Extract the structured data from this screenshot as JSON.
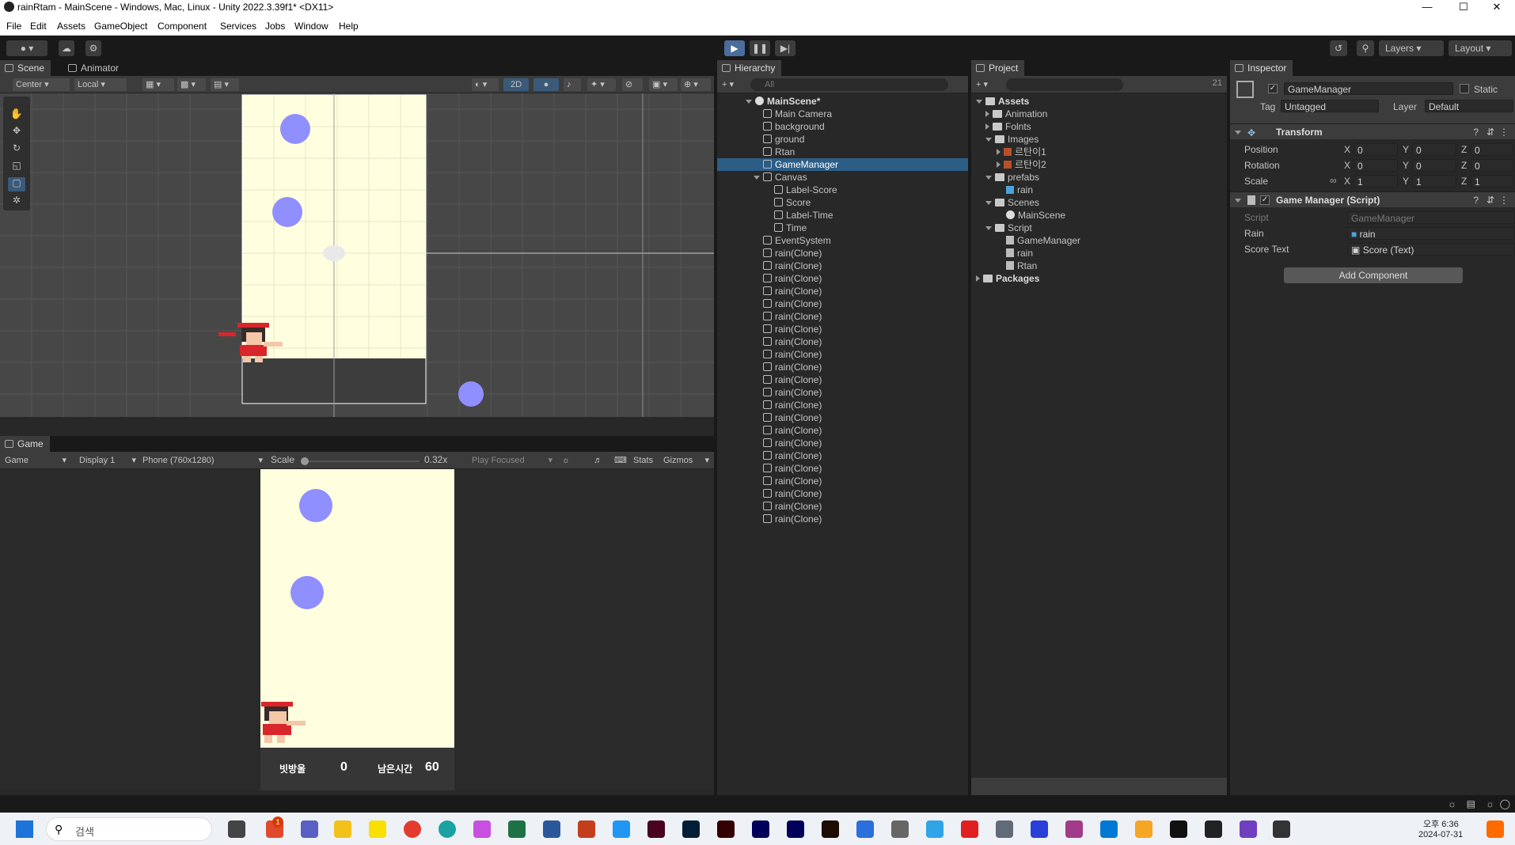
{
  "window": {
    "title": "rainRtam - MainScene - Windows, Mac, Linux - Unity 2022.3.39f1* <DX11>"
  },
  "menu": [
    "File",
    "Edit",
    "Assets",
    "GameObject",
    "Component",
    "Services",
    "Jobs",
    "Window",
    "Help"
  ],
  "toolbar": {
    "layers_label": "Layers",
    "layout_label": "Layout"
  },
  "scene_panel": {
    "tabs": [
      "Scene",
      "Animator"
    ],
    "pivot_label": "Center",
    "space_label": "Local",
    "mode_2d": "2D"
  },
  "game_panel": {
    "tab": "Game",
    "view_select": "Game",
    "display_select": "Display 1",
    "resolution_select": "Phone (760x1280)",
    "scale_label": "Scale",
    "scale_value": 0.32,
    "scale_text": "0.32x",
    "play_mode": "Play Focused",
    "stats_label": "Stats",
    "gizmos_label": "Gizmos",
    "hud": {
      "score_label": "빗방울",
      "score_value": "0",
      "time_label": "남은시간",
      "time_value": "60"
    }
  },
  "hierarchy": {
    "tab": "Hierarchy",
    "search_placeholder": "All",
    "scene": "MainScene*",
    "items": [
      "Main Camera",
      "background",
      "ground",
      "Rtan",
      "GameManager"
    ],
    "canvas": "Canvas",
    "canvas_children": [
      "Label-Score",
      "Score",
      "Label-Time",
      "Time"
    ],
    "after": [
      "EventSystem"
    ],
    "clones": [
      "rain(Clone)",
      "rain(Clone)",
      "rain(Clone)",
      "rain(Clone)",
      "rain(Clone)",
      "rain(Clone)",
      "rain(Clone)",
      "rain(Clone)",
      "rain(Clone)",
      "rain(Clone)",
      "rain(Clone)",
      "rain(Clone)",
      "rain(Clone)",
      "rain(Clone)",
      "rain(Clone)",
      "rain(Clone)",
      "rain(Clone)",
      "rain(Clone)",
      "rain(Clone)",
      "rain(Clone)",
      "rain(Clone)",
      "rain(Clone)"
    ]
  },
  "project": {
    "tab": "Project",
    "hidden_count": "21",
    "assets": "Assets",
    "folders": {
      "animation": "Animation",
      "fonts": "Folnts",
      "images": "Images",
      "image1": "르탄이1",
      "image2": "르탄이2",
      "prefabs": "prefabs",
      "prefab_rain": "rain",
      "scenes": "Scenes",
      "mainscene": "MainScene",
      "script": "Script",
      "s_gm": "GameManager",
      "s_rain": "rain",
      "s_rtan": "Rtan"
    },
    "packages": "Packages"
  },
  "inspector": {
    "tab": "Inspector",
    "object_name": "GameManager",
    "static_label": "Static",
    "tag_label": "Tag",
    "tag_value": "Untagged",
    "layer_label": "Layer",
    "layer_value": "Default",
    "transform": {
      "title": "Transform",
      "position_label": "Position",
      "rotation_label": "Rotation",
      "scale_label": "Scale",
      "axis_x": "X",
      "axis_y": "Y",
      "axis_z": "Z",
      "position": [
        "0",
        "0",
        "0"
      ],
      "rotation": [
        "0",
        "0",
        "0"
      ],
      "scale": [
        "1",
        "1",
        "1"
      ]
    },
    "script_component": {
      "title": "Game Manager (Script)",
      "script_label": "Script",
      "script_value": "GameManager",
      "rain_label": "Rain",
      "rain_value": "rain",
      "score_label": "Score Text",
      "score_value": "Score (Text)"
    },
    "add_component": "Add Component"
  },
  "taskbar": {
    "search_placeholder": "검색",
    "clock_time": "오후 6:36",
    "clock_date": "2024-07-31",
    "notification_badge": "1"
  }
}
